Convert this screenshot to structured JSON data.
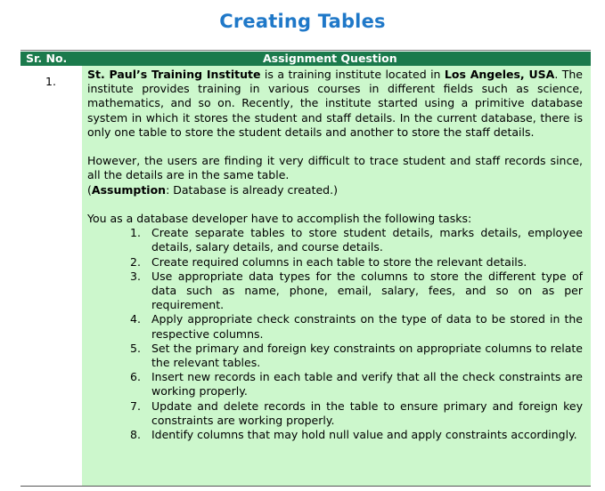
{
  "document": {
    "title": "Creating Tables",
    "table": {
      "col_srno": "Sr. No.",
      "col_question": "Assignment Question",
      "row": {
        "srno": "1.",
        "p1": {
          "institute": "St. Paul’s Training Institute",
          "t1": " is a training institute located in ",
          "location": "Los Angeles, USA",
          "t2": ". The institute provides training in various courses in different fields such as science, mathematics, and so on. Recently, the institute started using a primitive database system in which it stores the student and staff details. In the current database, there is only one table to store the student details and another to store the staff details."
        },
        "p2": {
          "text": "However, the users are finding it very difficult to trace student and staff records since, all the details are in the same table.",
          "paren_open": "(",
          "assumption_label": "Assumption",
          "assumption_text": ": Database is already created.)"
        },
        "p3_intro": "You as a database developer have to accomplish the following tasks:",
        "tasks": [
          {
            "num": "1.",
            "text": "Create separate tables to store student details, marks details, employee details, salary details, and course details."
          },
          {
            "num": "2.",
            "text": "Create required columns in each table to store the relevant details."
          },
          {
            "num": "3.",
            "text": "Use appropriate data types for the columns to store the different type of data such as name, phone, email, salary, fees, and so on as per requirement."
          },
          {
            "num": "4.",
            "text": "Apply appropriate check constraints on the type of data to be stored in the respective columns."
          },
          {
            "num": "5.",
            "text": "Set the primary and foreign key constraints on appropriate columns to relate the relevant tables."
          },
          {
            "num": "6.",
            "text": "Insert new records in each table and verify that all the check constraints are working properly."
          },
          {
            "num": "7.",
            "text": "Update and delete records in the table to ensure primary and foreign key constraints are working properly."
          },
          {
            "num": "8.",
            "text": "Identify columns that may hold null value and apply constraints accordingly."
          }
        ]
      }
    }
  },
  "colors": {
    "title": "#1f78c8",
    "header_bg": "#1b7a4c",
    "header_text": "#ffffff",
    "question_bg": "#ccf7cc"
  }
}
